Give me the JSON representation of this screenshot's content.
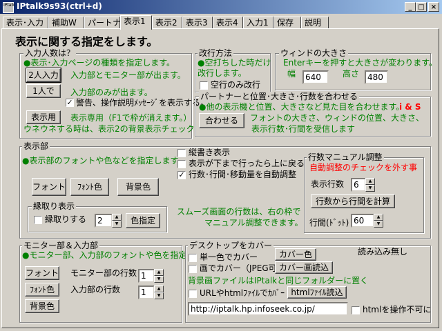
{
  "window": {
    "title": "IPtalk9s93(ctrl+d)",
    "icon_text": "IPtalk"
  },
  "tabs": [
    "表示･入力",
    "補助W",
    "パートナー",
    "表示1",
    "表示2",
    "表示3",
    "表示4",
    "入力1",
    "保存",
    "説明"
  ],
  "page_title": "表示に関する指定をします。",
  "input_group": {
    "title": "入力人数は？",
    "desc": "●表示･入力ページの種類を指定します。",
    "btn_two": "2人入力",
    "two_desc": "入力部とモニター部が出ます。",
    "btn_one": "1人で",
    "one_desc": "入力部のみが出ます。",
    "warn_label": "警告、操作説明ﾒｯｾｰｼﾞを表示する。",
    "btn_display": "表示用",
    "display_desc": "表示専用（F1で枠が消えます。）",
    "note": "ウネウネする時は、表示2の背景表示チェック"
  },
  "wrap_group": {
    "title": "改行方法",
    "desc1": "●空打ちした時だけ",
    "desc2": "改行します。",
    "check_label": "空行のみ改行"
  },
  "window_size": {
    "title": "ウィンドの大きさ",
    "desc": "Enterキーを押すと大きさが変わります。",
    "width_label": "幅",
    "width_value": "640",
    "height_label": "高さ",
    "height_value": "480"
  },
  "partner_group": {
    "title": "パートナーと位置･大きさ･行数を合わせる",
    "desc": "●他の表示機と位置、大きさなど見た目を合わせます。",
    "tag": "i & S",
    "btn": "合わせる",
    "desc2": "フォントの大きさ、ウィンドの位置、大きさ、",
    "desc3": "表示行数･行間を受信します"
  },
  "display_group": {
    "title": "表示部",
    "desc": "●表示部のフォントや色などを指定します。",
    "btn_font": "フォント",
    "btn_font_color": "ﾌｫﾝﾄ色",
    "btn_bg_color": "背景色",
    "vertical_label": "縦書き表示",
    "wrap_top_label": "表示が下まで行ったら上に戻る",
    "auto_adjust_label": "行数･行間･移動量を自動調整",
    "outline_title": "縁取り表示",
    "outline_check": "縁取りする",
    "outline_value": "2",
    "btn_color": "色指定",
    "smooth1": "スムーズ画面の行数は、右の枠で",
    "smooth2": "マニュアル調整できます。"
  },
  "manual_group": {
    "title": "行数マニュアル調整",
    "warn": "自動調整のチェックを外す事",
    "lines_label": "表示行数",
    "lines_value": "6",
    "btn_calc": "行数から行間を計算",
    "spacing_label": "行間(ﾄﾞｯﾄ)",
    "spacing_value": "60"
  },
  "monitor_group": {
    "title": "モニター部＆入力部",
    "desc": "●モニター部、入力部のフォントや色を指定",
    "btn_font": "フォント",
    "btn_font_color": "ﾌｫﾝﾄ色",
    "btn_bg_color": "背景色",
    "monitor_lines_label": "モニター部の行数",
    "monitor_lines_value": "1",
    "input_lines_label": "入力部の行数",
    "input_lines_value": "1"
  },
  "desktop_group": {
    "title": "デスクトップをカバー",
    "mono_label": "単一色でカバー",
    "btn_cover_color": "カバー色",
    "no_load": "読み込み無し",
    "image_label": "画でカバー（JPEG可）",
    "btn_cover_image": "カバー画読込",
    "note": "背景画ファイルはIPtalkと同じフォルダーに置く",
    "url_label": "URLやhtmlﾌｧｲﾙでｶﾊﾞｰ",
    "btn_html": "htmlﾌｧｲﾙ読込",
    "url_value": "http://iptalk.hp.infoseek.co.jp/",
    "html_disable_label": "htmlを操作不可に"
  },
  "state": {
    "warn_checked": true,
    "auto_adjust_checked": true
  }
}
